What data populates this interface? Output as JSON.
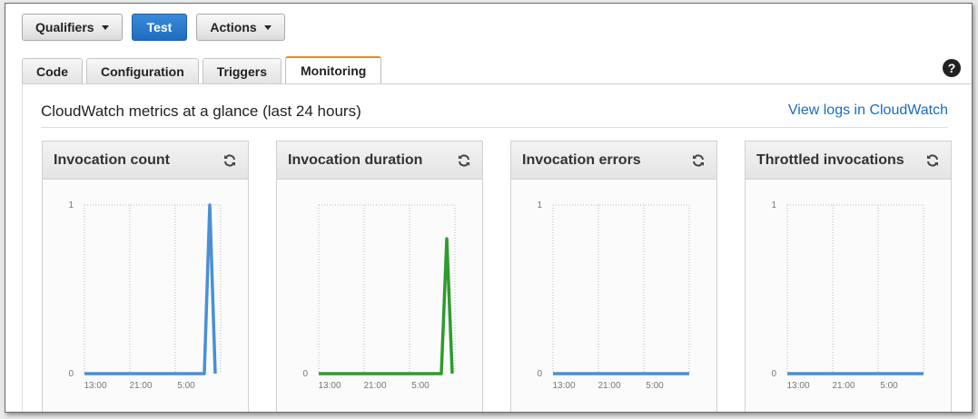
{
  "toolbar": {
    "qualifiers_label": "Qualifiers",
    "test_label": "Test",
    "actions_label": "Actions"
  },
  "tabs": [
    {
      "label": "Code",
      "active": false
    },
    {
      "label": "Configuration",
      "active": false
    },
    {
      "label": "Triggers",
      "active": false
    },
    {
      "label": "Monitoring",
      "active": true
    }
  ],
  "help_icon": "question-circle-icon",
  "panel": {
    "title": "CloudWatch metrics at a glance (last 24 hours)",
    "link": "View logs in CloudWatch"
  },
  "colors": {
    "primary_button": "#1f6cc0",
    "active_tab_accent": "#e58a1f",
    "link": "#1a6bc2",
    "series_blue": "#4a8fd6",
    "series_green": "#2e9b2e"
  },
  "chart_data": [
    {
      "type": "line",
      "title": "Invocation count",
      "x_ticks": [
        "13:00",
        "21:00",
        "5:00"
      ],
      "y_ticks": [
        "1",
        "0"
      ],
      "ylim": [
        0,
        1
      ],
      "color": "#4a8fd6",
      "series": [
        {
          "points": [
            [
              0,
              0
            ],
            [
              0.88,
              0
            ],
            [
              0.92,
              1
            ],
            [
              0.96,
              0
            ]
          ]
        }
      ]
    },
    {
      "type": "line",
      "title": "Invocation duration",
      "x_ticks": [
        "13:00",
        "21:00",
        "5:00"
      ],
      "y_ticks": [
        "0"
      ],
      "ylim": [
        0,
        1
      ],
      "color": "#2e9b2e",
      "series": [
        {
          "points": [
            [
              0,
              0
            ],
            [
              0.9,
              0
            ],
            [
              0.94,
              0.8
            ],
            [
              0.98,
              0
            ]
          ]
        }
      ]
    },
    {
      "type": "line",
      "title": "Invocation errors",
      "x_ticks": [
        "13:00",
        "21:00",
        "5:00"
      ],
      "y_ticks": [
        "1",
        "0"
      ],
      "ylim": [
        0,
        1
      ],
      "color": "#4a8fd6",
      "series": [
        {
          "points": [
            [
              0,
              0
            ],
            [
              1,
              0
            ]
          ]
        }
      ]
    },
    {
      "type": "line",
      "title": "Throttled invocations",
      "x_ticks": [
        "13:00",
        "21:00",
        "5:00"
      ],
      "y_ticks": [
        "1",
        "0"
      ],
      "ylim": [
        0,
        1
      ],
      "color": "#4a8fd6",
      "series": [
        {
          "points": [
            [
              0,
              0
            ],
            [
              1,
              0
            ]
          ]
        }
      ]
    }
  ]
}
